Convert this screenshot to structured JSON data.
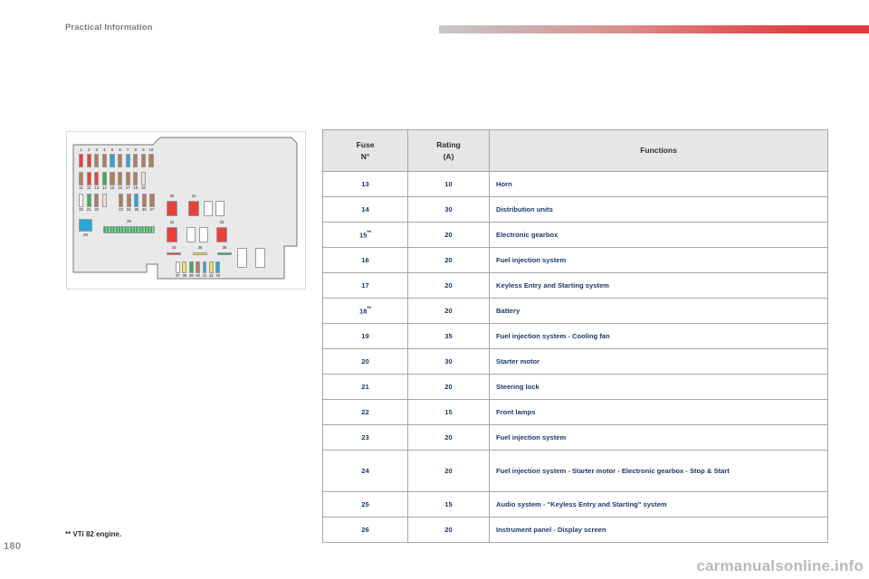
{
  "header": {
    "title": "Practical Information",
    "rule_color_start": "#c8c8c8",
    "rule_color_end": "#e23b3b"
  },
  "page_number": "180",
  "footnote": "** VTi 82 engine.",
  "watermark": "carmanualsonline.info",
  "figure": {
    "name": "engine-compartment-fuse-box-diagram",
    "body_fill": "#e9e9e9",
    "body_stroke": "#8c8c8c",
    "fuse_colors": {
      "red": "#e8413c",
      "brown": "#b07f5a",
      "blue": "#2ca6d8",
      "green": "#3faa5a",
      "white": "#ffffff",
      "pink": "#f7ded2",
      "yellow": "#f2e04a"
    },
    "rows": [
      {
        "name": "fuse-row-1-10",
        "labels_position": "top",
        "labels": [
          "1",
          "2",
          "3",
          "4",
          "5",
          "6",
          "7",
          "8",
          "9",
          "10"
        ],
        "colors": [
          "red",
          "red",
          "brown",
          "brown",
          "blue",
          "brown",
          "blue",
          "brown",
          "brown",
          "brown"
        ]
      },
      {
        "name": "fuse-row-11-19",
        "labels_position": "bottom",
        "labels": [
          "11",
          "12",
          "13",
          "14",
          "15",
          "16",
          "17",
          "18",
          "19"
        ],
        "colors": [
          "brown",
          "red",
          "red",
          "green",
          "brown",
          "brown",
          "brown",
          "brown",
          "pink"
        ]
      },
      {
        "name": "fuse-row-20-22",
        "labels_position": "bottom",
        "labels": [
          "20",
          "21",
          "22"
        ],
        "colors": [
          "white",
          "green",
          "brown"
        ]
      },
      {
        "name": "fuse-row-23-27",
        "labels_position": "bottom",
        "labels": [
          "23",
          "24",
          "25",
          "26",
          "27"
        ],
        "colors": [
          "brown",
          "brown",
          "blue",
          "brown",
          "brown"
        ]
      },
      {
        "name": "fuse-row-37-43",
        "labels_position": "bottom",
        "labels": [
          "37",
          "38",
          "39",
          "40",
          "41",
          "42",
          "43"
        ],
        "colors": [
          "white",
          "yellow",
          "green",
          "brown",
          "blue",
          "yellow",
          "blue"
        ]
      }
    ],
    "relays": [
      {
        "name": "relay-28",
        "label": "28",
        "color": "blue",
        "label_position": "bottom"
      },
      {
        "name": "relay-29",
        "label": "29",
        "color": "green",
        "label_position": "top"
      },
      {
        "name": "relay-30",
        "label": "30",
        "color": "red",
        "label_position": "top"
      },
      {
        "name": "relay-31",
        "label": "31",
        "color": "red",
        "label_position": "top"
      },
      {
        "name": "relay-32",
        "label": "32",
        "color": "red",
        "label_position": "top"
      },
      {
        "name": "relay-33",
        "label": "33",
        "color": "red",
        "label_position": "top"
      },
      {
        "name": "relay-34",
        "label": "34",
        "color": "red",
        "label_position": "top"
      },
      {
        "name": "relay-35",
        "label": "35",
        "color": "yellow",
        "label_position": "top"
      },
      {
        "name": "relay-36",
        "label": "36",
        "color": "green",
        "label_position": "top"
      }
    ],
    "empty_slots_count": 8
  },
  "table": {
    "headers": {
      "fuse": "Fuse\nN°",
      "fuse_line1": "Fuse",
      "fuse_line2": "N°",
      "rating_line1": "Rating",
      "rating_line2": "(A)",
      "functions": "Functions"
    },
    "rows": [
      {
        "fuse": "13",
        "rating": "10",
        "functions": "Horn"
      },
      {
        "fuse": "14",
        "rating": "30",
        "functions": "Distribution units"
      },
      {
        "fuse": "15**",
        "rating": "20",
        "functions": "Electronic gearbox"
      },
      {
        "fuse": "16",
        "rating": "20",
        "functions": "Fuel injection system"
      },
      {
        "fuse": "17",
        "rating": "20",
        "functions": "Keyless Entry and Starting system"
      },
      {
        "fuse": "18**",
        "rating": "20",
        "functions": "Battery"
      },
      {
        "fuse": "19",
        "rating": "35",
        "functions": "Fuel injection system - Cooling fan"
      },
      {
        "fuse": "20",
        "rating": "30",
        "functions": "Starter motor"
      },
      {
        "fuse": "21",
        "rating": "20",
        "functions": "Steering lock"
      },
      {
        "fuse": "22",
        "rating": "15",
        "functions": "Front lamps"
      },
      {
        "fuse": "23",
        "rating": "20",
        "functions": "Fuel injection system"
      },
      {
        "fuse": "24",
        "rating": "20",
        "functions": "Fuel injection system - Starter motor - Electronic gearbox - Stop & Start"
      },
      {
        "fuse": "25",
        "rating": "15",
        "functions": "Audio system - \"Keyless Entry and Starting\" system"
      },
      {
        "fuse": "26",
        "rating": "20",
        "functions": "Instrument panel - Display screen"
      }
    ]
  }
}
